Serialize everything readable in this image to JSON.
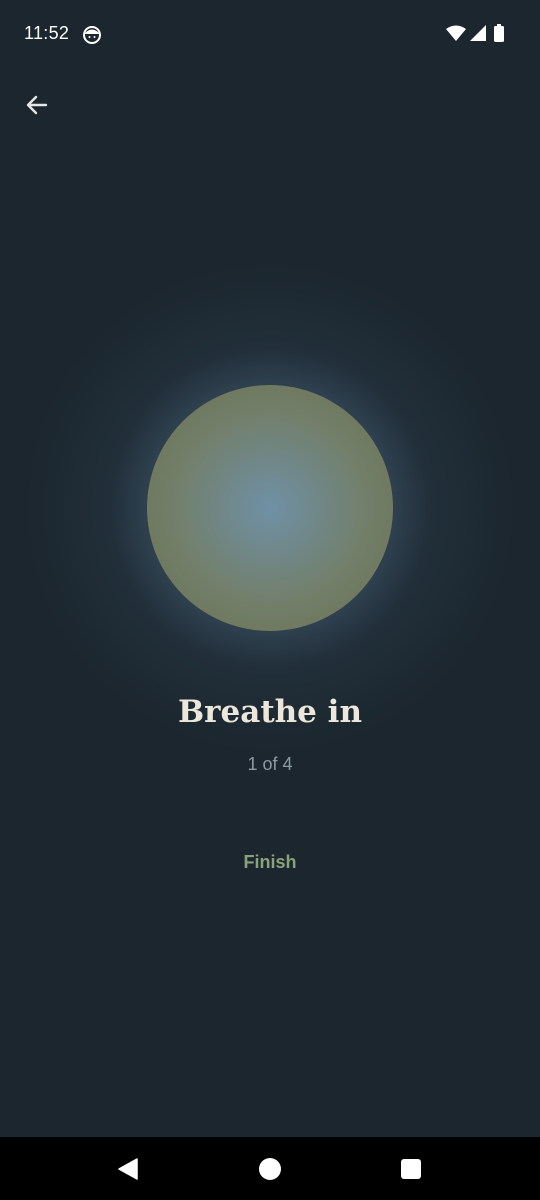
{
  "status_bar": {
    "time": "11:52",
    "app_icon": "face-notification-icon",
    "wifi_icon": "wifi-icon",
    "signal_icon": "cell-signal-icon",
    "battery_icon": "battery-icon"
  },
  "toolbar": {
    "back_icon": "arrow-left-icon"
  },
  "breathing": {
    "title": "Breathe in",
    "progress": "1 of 4",
    "finish_label": "Finish"
  },
  "nav_bar": {
    "back_icon": "triangle-back-icon",
    "home_icon": "circle-home-icon",
    "recents_icon": "square-recents-icon"
  },
  "colors": {
    "background": "#1b262e",
    "orb_center": "#6f90a6",
    "orb_edge": "#6a6f4e",
    "title": "#ece7da",
    "finish": "#8aa27a"
  }
}
